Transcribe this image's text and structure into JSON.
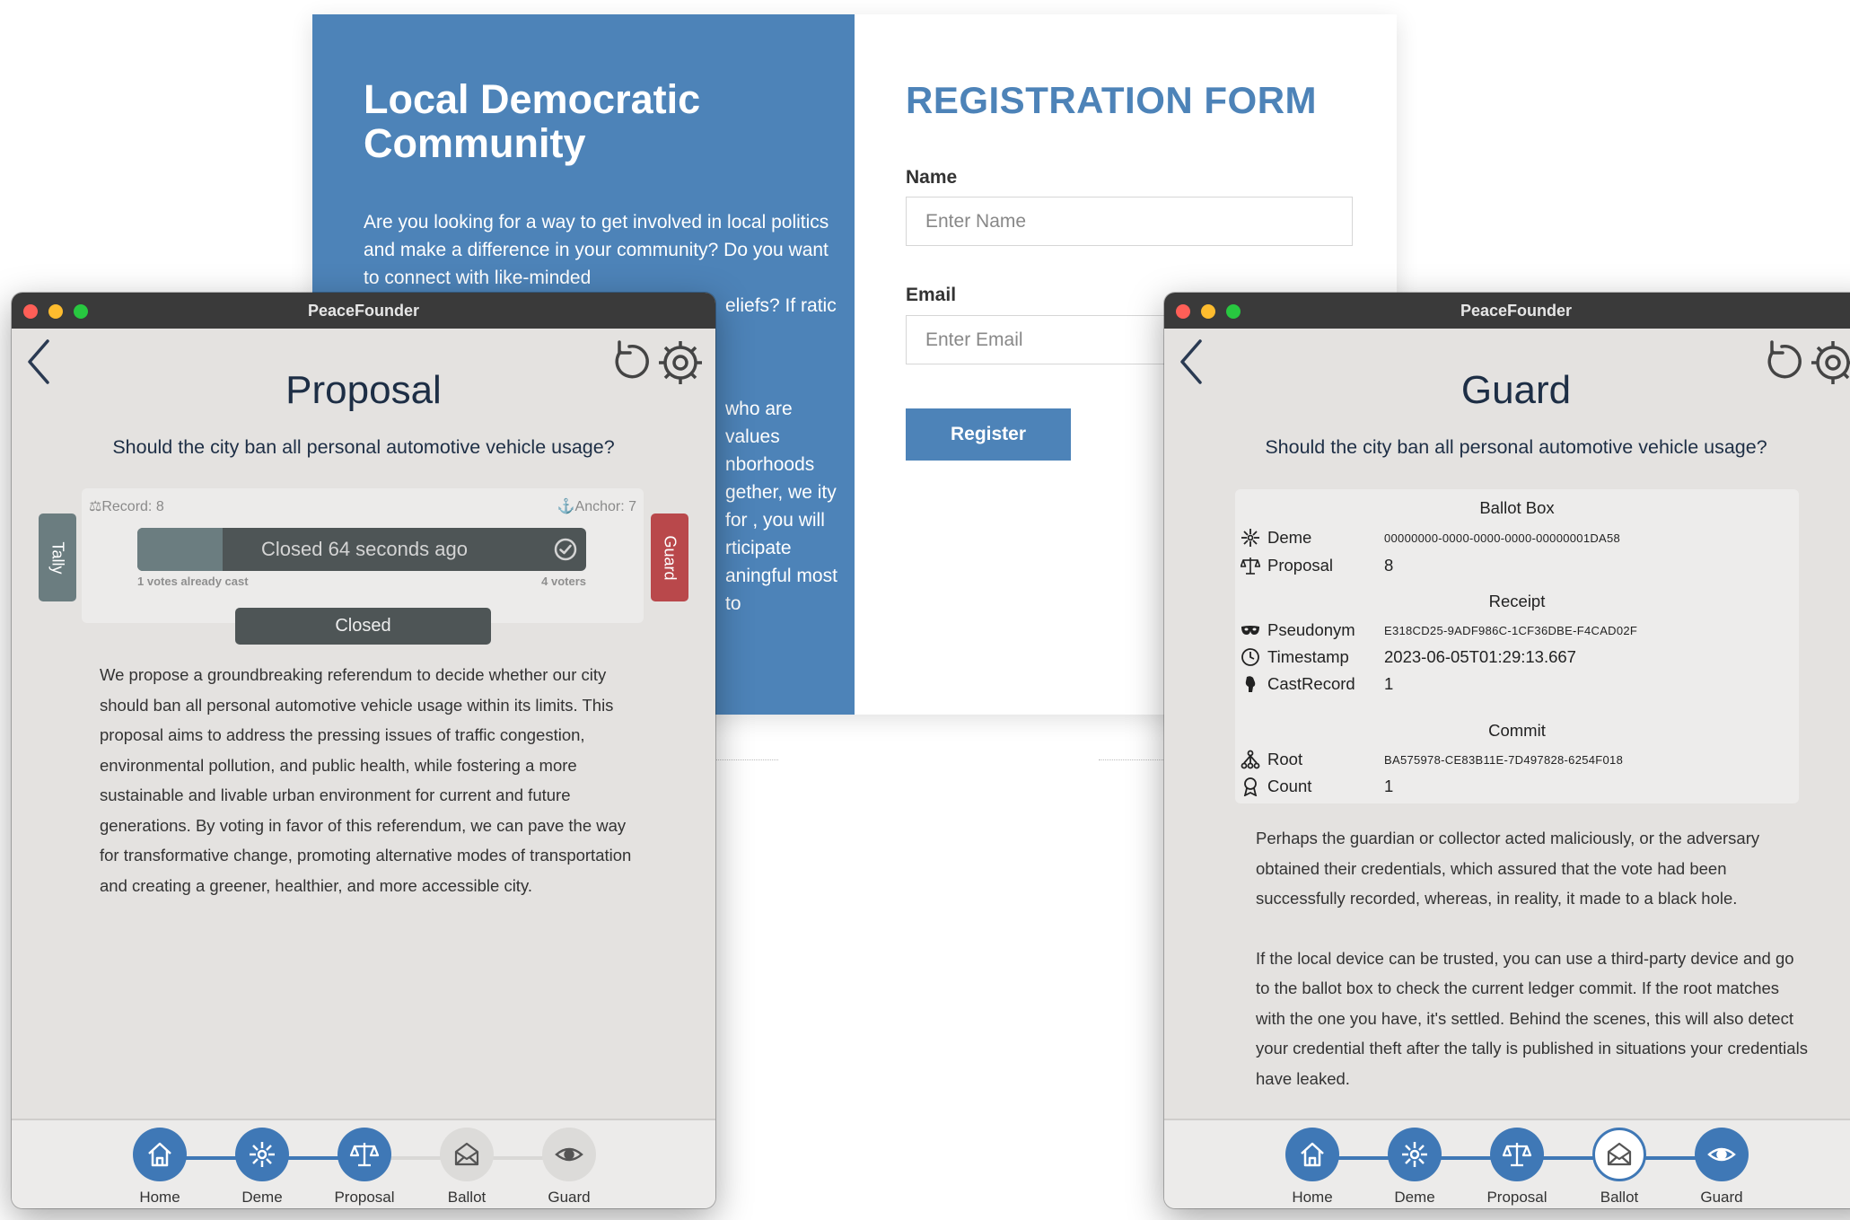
{
  "registration": {
    "title": "Local Democratic Community",
    "intro_line1": "Are you looking for a way to get involved in local politics and make a difference in your community? Do you want to connect with like-minded",
    "intro_line2": "eliefs? If ratic",
    "intro_para2": "who are values nborhoods gether, we ity for , you will rticipate aningful most to",
    "form_title": "REGISTRATION FORM",
    "name_label": "Name",
    "name_placeholder": "Enter Name",
    "email_label": "Email",
    "email_placeholder": "Enter Email",
    "register_button": "Register",
    "accent_color": "#4d83b8"
  },
  "proposal_window": {
    "app_title": "PeaceFounder",
    "heading": "Proposal",
    "question": "Should the city ban all personal automotive vehicle usage?",
    "record": "Record: 8",
    "anchor": "Anchor: 7",
    "status_text": "Closed 64 seconds ago",
    "progress_fraction": 0.19,
    "votes_cast": "1 votes already cast",
    "voters": "4 voters",
    "closed_button": "Closed",
    "tally_tab": "Tally",
    "guard_tab": "Guard",
    "description": "We propose a groundbreaking referendum to decide whether our city should ban all personal automotive vehicle usage within its limits. This proposal aims to address the pressing issues of traffic congestion, environmental pollution, and public health, while fostering a more sustainable and livable urban environment for current and future generations. By voting in favor of this referendum, we can pave the way for transformative change, promoting alternative modes of transportation and creating a greener, healthier, and more accessible city.",
    "nav": [
      "Home",
      "Deme",
      "Proposal",
      "Ballot",
      "Guard"
    ]
  },
  "guard_window": {
    "app_title": "PeaceFounder",
    "heading": "Guard",
    "question": "Should the city ban all personal automotive vehicle usage?",
    "ballot_box_title": "Ballot Box",
    "deme_label": "Deme",
    "deme_value": "00000000-0000-0000-0000-00000001DA58",
    "proposal_label": "Proposal",
    "proposal_value": "8",
    "receipt_title": "Receipt",
    "pseudonym_label": "Pseudonym",
    "pseudonym_value": "E318CD25-9ADF986C-1CF36DBE-F4CAD02F",
    "timestamp_label": "Timestamp",
    "timestamp_value": "2023-06-05T01:29:13.667",
    "castrecord_label": "CastRecord",
    "castrecord_value": "1",
    "commit_title": "Commit",
    "root_label": "Root",
    "root_value": "BA575978-CE83B11E-7D497828-6254F018",
    "count_label": "Count",
    "count_value": "1",
    "text_para1": "Perhaps the guardian or collector acted maliciously, or the adversary obtained their credentials, which assured that the vote had been successfully recorded, whereas, in reality, it made to a black hole.",
    "text_para2": "If the local device can be trusted, you can use a third-party device and go to the ballot box to check the current ledger commit. If the root matches with the one you have, it's settled. Behind the scenes, this will also detect your credential theft after the tally is published in situations your credentials have leaked.",
    "nav": [
      "Home",
      "Deme",
      "Proposal",
      "Ballot",
      "Guard"
    ]
  },
  "colors": {
    "nav_active": "#3f78b6",
    "guard_tab": "#b9484b",
    "tally_tab": "#6b7d80"
  }
}
